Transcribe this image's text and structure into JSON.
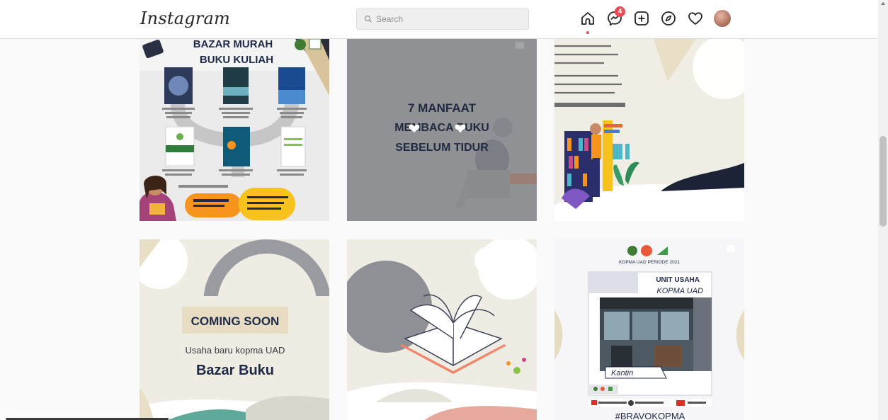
{
  "app": {
    "logo": "Instagram"
  },
  "search": {
    "placeholder": "Search"
  },
  "nav": {
    "messages_badge": "4"
  },
  "posts": [
    {
      "title_line1": "BAZAR MURAH",
      "title_line2": "BUKU KULIAH"
    },
    {
      "line1": "7 MANFAAT",
      "line2": "MEMBACA BUKU",
      "line3": "SEBELUM TIDUR"
    },
    {},
    {
      "banner": "COMING SOON",
      "subtitle": "Usaha baru kopma UAD",
      "title": "Bazar Buku"
    },
    {},
    {
      "header": "KOPMA UAD PERIODE 2021",
      "line1": "UNIT USAHA",
      "line2": "KOPMA UAD",
      "label": "Kantin",
      "hashtag": "#BRAVOKOPMA"
    }
  ],
  "colors": {
    "badge": "#ed4956",
    "accent_orange": "#f7941d",
    "navy": "#1e2a4a"
  }
}
